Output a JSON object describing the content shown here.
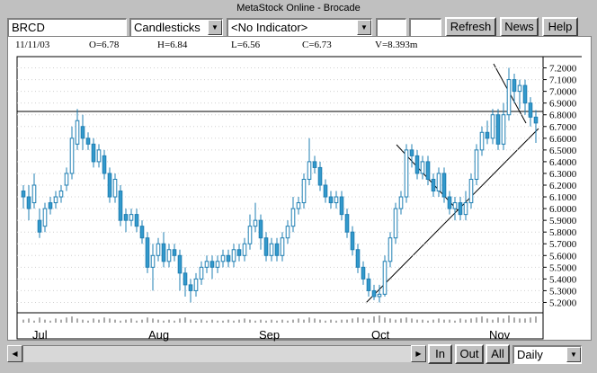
{
  "window": {
    "title": "MetaStock Online - Brocade"
  },
  "toolbar": {
    "symbol_value": "BRCD",
    "chart_type_selected": "Candlesticks",
    "indicator_selected": "<No Indicator>",
    "extra_field_1": "",
    "extra_field_2": "",
    "refresh_label": "Refresh",
    "news_label": "News",
    "help_label": "Help"
  },
  "info_bar": {
    "date": "11/11/03",
    "open": "O=6.78",
    "high": "H=6.84",
    "low": "L=6.56",
    "close": "C=6.73",
    "volume": "V=8.393m"
  },
  "bottom": {
    "zoom_in_label": "In",
    "zoom_out_label": "Out",
    "all_label": "All",
    "period_selected": "Daily"
  },
  "chart_data": {
    "type": "candlestick",
    "y_ticks": [
      "7.2000",
      "7.1000",
      "7.0000",
      "6.9000",
      "6.8000",
      "6.7000",
      "6.6000",
      "6.5000",
      "6.4000",
      "6.3000",
      "6.2000",
      "6.1000",
      "6.0000",
      "5.9000",
      "5.8000",
      "5.7000",
      "5.6000",
      "5.5000",
      "5.4000",
      "5.3000",
      "5.2000"
    ],
    "ylim": [
      5.15,
      7.25
    ],
    "x_labels": [
      "Jul",
      "Aug",
      "Sep",
      "Oct",
      "Nov"
    ],
    "candles": [
      [
        6.15,
        6.1,
        6.2,
        6.0
      ],
      [
        6.1,
        6.0,
        6.2,
        5.9
      ],
      [
        6.05,
        6.2,
        6.3,
        6.0
      ],
      [
        5.9,
        5.8,
        6.0,
        5.75
      ],
      [
        5.85,
        6.0,
        6.05,
        5.8
      ],
      [
        6.05,
        6.0,
        6.1,
        5.95
      ],
      [
        6.05,
        6.1,
        6.15,
        6.0
      ],
      [
        6.1,
        6.15,
        6.2,
        6.05
      ],
      [
        6.2,
        6.3,
        6.35,
        6.15
      ],
      [
        6.3,
        6.6,
        6.7,
        6.25
      ],
      [
        6.55,
        6.75,
        6.85,
        6.5
      ],
      [
        6.7,
        6.6,
        6.8,
        6.5
      ],
      [
        6.6,
        6.55,
        6.65,
        6.5
      ],
      [
        6.55,
        6.4,
        6.6,
        6.35
      ],
      [
        6.4,
        6.5,
        6.55,
        6.35
      ],
      [
        6.45,
        6.3,
        6.5,
        6.25
      ],
      [
        6.3,
        6.1,
        6.35,
        6.05
      ],
      [
        6.1,
        6.25,
        6.3,
        6.05
      ],
      [
        6.15,
        5.9,
        6.2,
        5.85
      ],
      [
        5.95,
        5.9,
        6.0,
        5.8
      ],
      [
        5.9,
        5.95,
        6.0,
        5.85
      ],
      [
        5.95,
        5.85,
        6.0,
        5.8
      ],
      [
        5.85,
        5.75,
        5.9,
        5.7
      ],
      [
        5.75,
        5.5,
        5.8,
        5.45
      ],
      [
        5.5,
        5.6,
        5.7,
        5.3
      ],
      [
        5.6,
        5.7,
        5.75,
        5.55
      ],
      [
        5.7,
        5.55,
        5.8,
        5.5
      ],
      [
        5.55,
        5.65,
        5.7,
        5.5
      ],
      [
        5.65,
        5.6,
        5.7,
        5.55
      ],
      [
        5.6,
        5.45,
        5.65,
        5.3
      ],
      [
        5.45,
        5.35,
        5.5,
        5.25
      ],
      [
        5.35,
        5.3,
        5.4,
        5.2
      ],
      [
        5.3,
        5.4,
        5.45,
        5.25
      ],
      [
        5.4,
        5.5,
        5.55,
        5.35
      ],
      [
        5.5,
        5.55,
        5.6,
        5.45
      ],
      [
        5.55,
        5.5,
        5.6,
        5.4
      ],
      [
        5.5,
        5.55,
        5.6,
        5.45
      ],
      [
        5.55,
        5.6,
        5.65,
        5.5
      ],
      [
        5.6,
        5.55,
        5.65,
        5.5
      ],
      [
        5.55,
        5.65,
        5.7,
        5.5
      ],
      [
        5.65,
        5.6,
        5.7,
        5.55
      ],
      [
        5.6,
        5.7,
        5.75,
        5.55
      ],
      [
        5.7,
        5.85,
        5.95,
        5.65
      ],
      [
        5.85,
        5.9,
        6.05,
        5.8
      ],
      [
        5.9,
        5.75,
        5.95,
        5.65
      ],
      [
        5.75,
        5.6,
        5.8,
        5.55
      ],
      [
        5.6,
        5.7,
        5.75,
        5.55
      ],
      [
        5.7,
        5.6,
        5.75,
        5.55
      ],
      [
        5.6,
        5.75,
        5.8,
        5.55
      ],
      [
        5.75,
        5.85,
        5.9,
        5.7
      ],
      [
        5.85,
        6.0,
        6.1,
        5.8
      ],
      [
        6.0,
        6.05,
        6.1,
        5.95
      ],
      [
        6.05,
        6.25,
        6.3,
        6.0
      ],
      [
        6.25,
        6.4,
        6.6,
        6.2
      ],
      [
        6.4,
        6.35,
        6.45,
        6.3
      ],
      [
        6.35,
        6.2,
        6.4,
        6.15
      ],
      [
        6.2,
        6.1,
        6.25,
        6.05
      ],
      [
        6.1,
        6.05,
        6.15,
        6.0
      ],
      [
        6.05,
        6.1,
        6.15,
        6.0
      ],
      [
        6.1,
        5.95,
        6.15,
        5.9
      ],
      [
        5.95,
        5.8,
        6.0,
        5.75
      ],
      [
        5.8,
        5.65,
        5.85,
        5.6
      ],
      [
        5.65,
        5.5,
        5.7,
        5.45
      ],
      [
        5.5,
        5.4,
        5.55,
        5.35
      ],
      [
        5.4,
        5.3,
        5.45,
        5.25
      ],
      [
        5.3,
        5.25,
        5.35,
        5.22
      ],
      [
        5.25,
        5.27,
        5.35,
        5.2
      ],
      [
        5.27,
        5.55,
        5.6,
        5.25
      ],
      [
        5.55,
        5.75,
        5.8,
        5.5
      ],
      [
        5.75,
        6.0,
        6.05,
        5.7
      ],
      [
        6.0,
        6.1,
        6.15,
        5.95
      ],
      [
        6.1,
        6.5,
        6.55,
        6.05
      ],
      [
        6.5,
        6.45,
        6.55,
        6.35
      ],
      [
        6.45,
        6.3,
        6.5,
        6.25
      ],
      [
        6.3,
        6.4,
        6.45,
        6.25
      ],
      [
        6.4,
        6.25,
        6.45,
        6.2
      ],
      [
        6.25,
        6.15,
        6.3,
        6.1
      ],
      [
        6.15,
        6.3,
        6.35,
        6.1
      ],
      [
        6.3,
        6.1,
        6.35,
        6.05
      ],
      [
        6.1,
        6.0,
        6.15,
        5.95
      ],
      [
        6.0,
        6.05,
        6.1,
        5.9
      ],
      [
        6.05,
        5.95,
        6.1,
        5.9
      ],
      [
        5.95,
        6.05,
        6.15,
        5.9
      ],
      [
        6.05,
        6.25,
        6.3,
        6.0
      ],
      [
        6.25,
        6.5,
        6.55,
        6.2
      ],
      [
        6.5,
        6.65,
        6.7,
        6.45
      ],
      [
        6.65,
        6.6,
        6.75,
        6.55
      ],
      [
        6.6,
        6.8,
        6.85,
        6.55
      ],
      [
        6.8,
        6.55,
        6.85,
        6.5
      ],
      [
        6.55,
        6.8,
        6.9,
        6.5
      ],
      [
        6.8,
        7.1,
        7.2,
        6.75
      ],
      [
        7.1,
        7.0,
        7.15,
        6.9
      ],
      [
        7.0,
        7.05,
        7.1,
        6.85
      ],
      [
        7.05,
        6.9,
        7.1,
        6.8
      ],
      [
        6.9,
        6.78,
        6.95,
        6.7
      ],
      [
        6.78,
        6.73,
        6.84,
        6.56
      ]
    ],
    "volumes": [
      3,
      4,
      2,
      5,
      3,
      2,
      4,
      3,
      5,
      6,
      4,
      3,
      2,
      4,
      3,
      5,
      4,
      3,
      2,
      3,
      4,
      2,
      3,
      5,
      4,
      3,
      2,
      3,
      2,
      4,
      5,
      3,
      2,
      3,
      2,
      3,
      2,
      2,
      3,
      2,
      3,
      4,
      3,
      2,
      3,
      2,
      3,
      2,
      3,
      2,
      3,
      4,
      3,
      5,
      4,
      3,
      2,
      3,
      2,
      3,
      3,
      4,
      5,
      4,
      3,
      6,
      7,
      5,
      4,
      3,
      4,
      5,
      4,
      3,
      3,
      2,
      3,
      4,
      3,
      3,
      2,
      4,
      3,
      4,
      5,
      6,
      4,
      3,
      5,
      4,
      7,
      5,
      4,
      4,
      5,
      6
    ]
  }
}
